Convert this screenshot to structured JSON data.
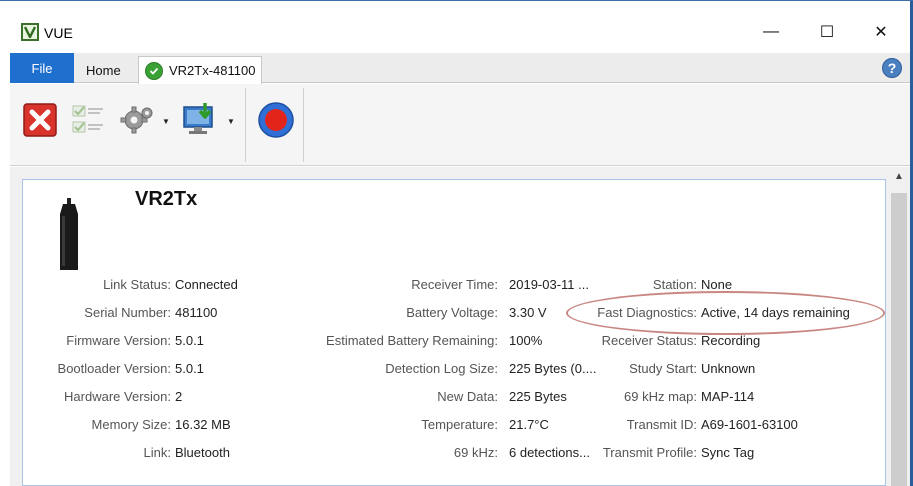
{
  "window": {
    "title": "VUE",
    "controls": {
      "minimize": "—",
      "maximize": "☐",
      "close": "✕"
    }
  },
  "ribbon": {
    "file_tab": "File",
    "home_tab": "Home",
    "device_tab": "VR2Tx-481100",
    "help": "?"
  },
  "toolbar": {
    "buttons": [
      "close-device",
      "checklist",
      "settings",
      "download",
      "record"
    ]
  },
  "device": {
    "name": "VR2Tx"
  },
  "col1": [
    {
      "label": "Link Status:",
      "value": "Connected"
    },
    {
      "label": "Serial Number:",
      "value": "481100"
    },
    {
      "label": "Firmware Version:",
      "value": "5.0.1"
    },
    {
      "label": "Bootloader Version:",
      "value": "5.0.1"
    },
    {
      "label": "Hardware Version:",
      "value": "2"
    },
    {
      "label": "Memory Size:",
      "value": "16.32 MB"
    },
    {
      "label": "Link:",
      "value": "Bluetooth"
    }
  ],
  "col2": [
    {
      "label": "Receiver Time:",
      "value": "2019-03-11 ..."
    },
    {
      "label": "Battery Voltage:",
      "value": "3.30 V"
    },
    {
      "label": "Estimated Battery Remaining:",
      "value": "100%"
    },
    {
      "label": "Detection Log Size:",
      "value": "225 Bytes (0...."
    },
    {
      "label": "New Data:",
      "value": "225 Bytes"
    },
    {
      "label": "Temperature:",
      "value": "21.7°C"
    },
    {
      "label": "69 kHz:",
      "value": "6 detections..."
    }
  ],
  "col3": [
    {
      "label": "Station:",
      "value": "None"
    },
    {
      "label": "Fast Diagnostics:",
      "value": "Active, 14 days remaining"
    },
    {
      "label": "Receiver Status:",
      "value": "Recording"
    },
    {
      "label": "Study Start:",
      "value": "Unknown"
    },
    {
      "label": "69 kHz map:",
      "value": "MAP-114"
    },
    {
      "label": "Transmit ID:",
      "value": "A69-1601-63100"
    },
    {
      "label": "Transmit Profile:",
      "value": "Sync Tag"
    }
  ],
  "colors": {
    "accent": "#1e6fce",
    "highlight": "#c98783",
    "panel_border": "#a9c5e3"
  }
}
